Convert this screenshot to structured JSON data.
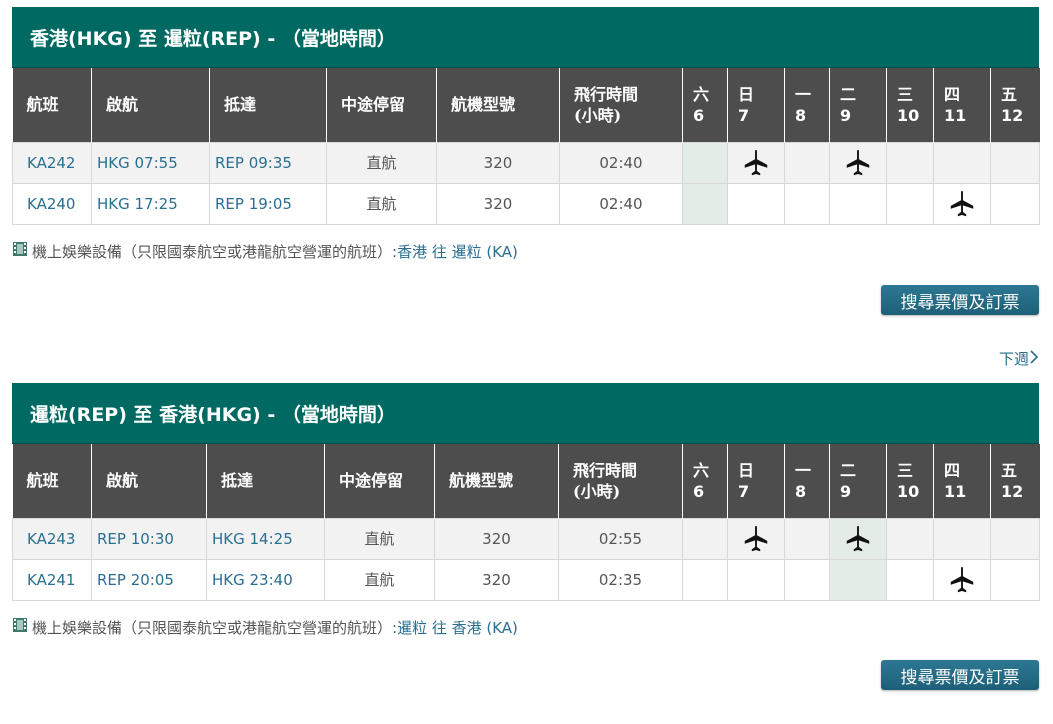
{
  "sections": [
    {
      "title": "香港(HKG) 至 暹粒(REP) - （當地時間）",
      "headers": {
        "flight": "航班",
        "depart": "啟航",
        "arrive": "抵達",
        "stops": "中途停留",
        "aircraft": "航機型號",
        "duration": "飛行時間(小時)",
        "duration_line1": "飛行時間",
        "duration_line2": "(小時)"
      },
      "days": [
        {
          "name": "六",
          "num": "6"
        },
        {
          "name": "日",
          "num": "7"
        },
        {
          "name": "一",
          "num": "8"
        },
        {
          "name": "二",
          "num": "9"
        },
        {
          "name": "三",
          "num": "10"
        },
        {
          "name": "四",
          "num": "11"
        },
        {
          "name": "五",
          "num": "12"
        }
      ],
      "flights": [
        {
          "flight": "KA242",
          "depart": "HKG 07:55",
          "arrive": "REP 09:35",
          "stops": "直航",
          "aircraft": "320",
          "duration": "02:40",
          "operates": [
            false,
            true,
            false,
            true,
            false,
            false,
            false
          ],
          "today_index": 0
        },
        {
          "flight": "KA240",
          "depart": "HKG 17:25",
          "arrive": "REP 19:05",
          "stops": "直航",
          "aircraft": "320",
          "duration": "02:40",
          "operates": [
            false,
            false,
            false,
            false,
            false,
            true,
            false
          ],
          "today_index": 0
        }
      ],
      "ife_text": "機上娛樂設備（只限國泰航空或港龍航空營運的航班）:",
      "ife_link": "香港 往 暹粒 (KA)",
      "button": "搜尋票價及訂票"
    },
    {
      "title": "暹粒(REP) 至 香港(HKG) - （當地時間）",
      "headers": {
        "flight": "航班",
        "depart": "啟航",
        "arrive": "抵達",
        "stops": "中途停留",
        "aircraft": "航機型號",
        "duration": "飛行時間(小時)",
        "duration_line1": "飛行時間",
        "duration_line2": "(小時)"
      },
      "days": [
        {
          "name": "六",
          "num": "6"
        },
        {
          "name": "日",
          "num": "7"
        },
        {
          "name": "一",
          "num": "8"
        },
        {
          "name": "二",
          "num": "9"
        },
        {
          "name": "三",
          "num": "10"
        },
        {
          "name": "四",
          "num": "11"
        },
        {
          "name": "五",
          "num": "12"
        }
      ],
      "flights": [
        {
          "flight": "KA243",
          "depart": "REP 10:30",
          "arrive": "HKG 14:25",
          "stops": "直航",
          "aircraft": "320",
          "duration": "02:55",
          "operates": [
            false,
            true,
            false,
            true,
            false,
            false,
            false
          ],
          "today_index": 3
        },
        {
          "flight": "KA241",
          "depart": "REP 20:05",
          "arrive": "HKG 23:40",
          "stops": "直航",
          "aircraft": "320",
          "duration": "02:35",
          "operates": [
            false,
            false,
            false,
            false,
            false,
            true,
            false
          ],
          "today_index": 3
        }
      ],
      "ife_text": "機上娛樂設備（只限國泰航空或港龍航空營運的航班）:",
      "ife_link": "暹粒 往 香港 (KA)",
      "button": "搜尋票價及訂票"
    }
  ],
  "next_week": "下週",
  "icons": {
    "plane": "airplane-icon",
    "film": "film-icon",
    "chevron": "chevron-right-icon"
  },
  "colors": {
    "header_bar": "#006a62",
    "table_header": "#4d4d4d",
    "link": "#2a6f92",
    "button": "#1e5f78"
  }
}
